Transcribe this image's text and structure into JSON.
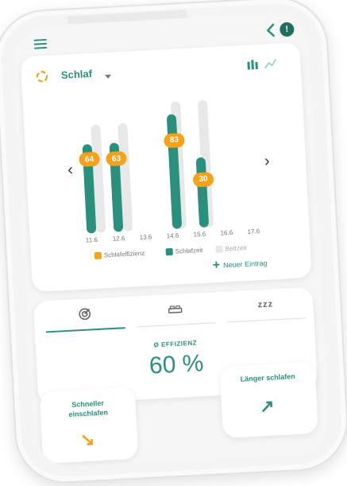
{
  "header": {
    "menu_icon": "hamburger-menu-icon",
    "back_icon": "chevron-left-icon",
    "alert_icon": "alert-badge-icon",
    "alert_symbol": "!"
  },
  "chart_header": {
    "title": "Schlaf",
    "sync_icon": "sync-circle-icon",
    "dropdown_icon": "chevron-down-icon",
    "bar_view_icon": "bar-chart-icon",
    "line_view_icon": "line-chart-icon"
  },
  "chart_data": {
    "type": "bar",
    "categories": [
      "11.6",
      "12.6",
      "13.6",
      "14.6",
      "15.6",
      "16.6",
      "17.6"
    ],
    "series": [
      {
        "name": "Schlafeffizienz",
        "values": [
          64,
          63,
          null,
          83,
          30,
          null,
          null
        ]
      },
      {
        "name": "Schlafzeit",
        "values": [
          7.0,
          7.0,
          null,
          9.0,
          5.5,
          null,
          null
        ]
      },
      {
        "name": "Bettzeit",
        "values": [
          8.5,
          8.5,
          null,
          10.0,
          10.0,
          null,
          null
        ]
      }
    ],
    "ylim": [
      0,
      11
    ]
  },
  "nav": {
    "prev": "‹",
    "next": "›"
  },
  "legend": [
    {
      "label": "Schlafeffizienz",
      "color": "#f4a21b"
    },
    {
      "label": "Schlafzeit",
      "color": "#2a8f7c"
    },
    {
      "label": "Bettzeit",
      "color": "#e8e8e8"
    }
  ],
  "new_entry": {
    "plus": "+",
    "label": "Neuer Eintrag"
  },
  "tabs": [
    {
      "icon": "efficiency-target-icon",
      "active": true
    },
    {
      "icon": "bed-icon",
      "active": false
    },
    {
      "icon": "sleep-zzz-icon",
      "text": "zzz",
      "active": false
    }
  ],
  "efficiency": {
    "label": "Ø EFFIZIENZ",
    "value": "60 %"
  },
  "actions": [
    {
      "label": "Schneller einschlafen",
      "arrow": "↘",
      "icon": "arrow-down-right-icon",
      "color": "#f4a21b"
    },
    {
      "label": "Länger schlafen",
      "arrow": "↗",
      "icon": "arrow-up-right-icon",
      "color": "#2a8f7c"
    }
  ]
}
